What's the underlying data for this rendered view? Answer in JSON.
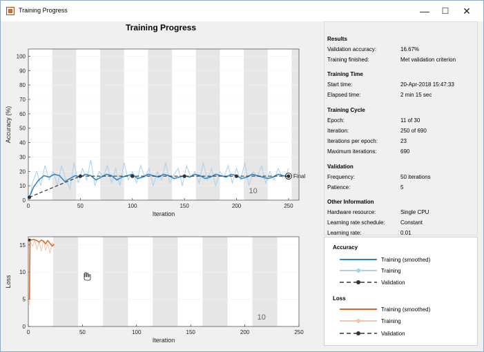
{
  "window": {
    "title": "Training Progress",
    "controls": {
      "minimize": "—",
      "maximize": "☐",
      "close": "✕"
    }
  },
  "plot_title": "Training Progress",
  "colors": {
    "accuracy_smoothed": "#2f86c8",
    "accuracy_raw": "#aad0ea",
    "validation": "#333333",
    "loss_smoothed": "#d9652c",
    "loss_raw": "#f3c4ae",
    "epoch_band": "#e6e6e6"
  },
  "chart_data": [
    {
      "type": "line",
      "name": "accuracy",
      "xlabel": "Iteration",
      "ylabel": "Accuracy (%)",
      "xlim": [
        0,
        260
      ],
      "ylim": [
        0,
        105
      ],
      "xticks": [
        0,
        50,
        100,
        150,
        200,
        250
      ],
      "yticks": [
        0,
        10,
        20,
        30,
        40,
        50,
        60,
        70,
        80,
        90,
        100
      ],
      "epoch_label": "10",
      "final_label": "Final",
      "epoch_bands": [
        [
          23,
          46
        ],
        [
          69,
          92
        ],
        [
          115,
          138
        ],
        [
          161,
          184
        ],
        [
          207,
          230
        ],
        [
          253,
          260
        ]
      ],
      "series": [
        {
          "name": "Training (smoothed)",
          "x": [
            1,
            5,
            10,
            15,
            20,
            25,
            30,
            35,
            40,
            45,
            50,
            55,
            60,
            65,
            70,
            75,
            80,
            85,
            90,
            95,
            100,
            105,
            110,
            115,
            120,
            125,
            130,
            135,
            140,
            145,
            150,
            155,
            160,
            165,
            170,
            175,
            180,
            185,
            190,
            195,
            200,
            205,
            210,
            215,
            220,
            225,
            230,
            235,
            240,
            245,
            250
          ],
          "y": [
            2,
            9,
            14,
            17,
            16,
            18,
            17,
            13,
            15,
            17,
            16,
            18,
            17,
            14,
            16,
            18,
            17,
            14,
            16,
            17,
            18,
            15,
            16,
            18,
            17,
            16,
            18,
            17,
            15,
            16,
            17,
            16,
            18,
            17,
            15,
            16,
            18,
            17,
            16,
            18,
            17,
            15,
            16,
            18,
            17,
            16,
            15,
            16,
            18,
            17,
            16
          ]
        },
        {
          "name": "Training",
          "x": [
            1,
            4,
            8,
            12,
            16,
            20,
            24,
            28,
            32,
            36,
            40,
            44,
            48,
            52,
            56,
            60,
            64,
            68,
            72,
            76,
            80,
            84,
            88,
            92,
            96,
            100,
            104,
            108,
            112,
            116,
            120,
            124,
            128,
            132,
            136,
            140,
            144,
            148,
            152,
            156,
            160,
            164,
            168,
            172,
            176,
            180,
            184,
            188,
            192,
            196,
            200,
            204,
            208,
            212,
            216,
            220,
            224,
            228,
            232,
            236,
            240,
            244,
            248,
            250
          ],
          "y": [
            0,
            12,
            20,
            10,
            24,
            14,
            20,
            10,
            24,
            14,
            8,
            26,
            12,
            22,
            14,
            28,
            10,
            20,
            16,
            24,
            12,
            22,
            10,
            26,
            14,
            20,
            12,
            24,
            16,
            22,
            10,
            20,
            14,
            26,
            12,
            18,
            22,
            10,
            24,
            16,
            20,
            12,
            26,
            14,
            22,
            10,
            20,
            16,
            24,
            12,
            22,
            14,
            26,
            10,
            20,
            16,
            24,
            12,
            20,
            14,
            22,
            16,
            18,
            22
          ]
        },
        {
          "name": "Validation",
          "x": [
            1,
            50,
            100,
            150,
            200,
            250
          ],
          "y": [
            2,
            16.67,
            16.67,
            16.67,
            16.67,
            16.67
          ]
        }
      ]
    },
    {
      "type": "line",
      "name": "loss",
      "xlabel": "Iteration",
      "ylabel": "Loss",
      "xlim": [
        0,
        250
      ],
      "ylim": [
        0,
        16.5
      ],
      "xticks": [
        0,
        50,
        100,
        150,
        200,
        250
      ],
      "yticks": [
        0,
        5,
        10,
        15
      ],
      "epoch_label": "10",
      "epoch_bands": [
        [
          23,
          46
        ],
        [
          69,
          92
        ],
        [
          115,
          138
        ],
        [
          161,
          184
        ],
        [
          207,
          230
        ]
      ],
      "series": [
        {
          "name": "Training (smoothed)",
          "x": [
            1,
            1.5,
            2,
            3,
            5,
            8,
            10,
            12,
            14,
            16,
            18,
            20,
            22,
            24
          ],
          "y": [
            5,
            15.8,
            16,
            15.9,
            16,
            15.8,
            15.5,
            15.9,
            15.7,
            15.2,
            15.8,
            15.3,
            14.8,
            15.1
          ]
        },
        {
          "name": "Training",
          "x": [
            1,
            2,
            4,
            6,
            8,
            10,
            12,
            14,
            16,
            18,
            20,
            22,
            24
          ],
          "y": [
            4,
            15.5,
            14.8,
            15.9,
            14.2,
            15.6,
            13.8,
            15.8,
            14.0,
            15.2,
            13.5,
            15.4,
            14.6
          ]
        },
        {
          "name": "Validation",
          "x": [
            1
          ],
          "y": [
            15.9
          ]
        }
      ]
    }
  ],
  "results": {
    "title": "Results",
    "rows": [
      {
        "label": "Validation accuracy:",
        "value": "16.67%"
      },
      {
        "label": "Training finished:",
        "value": "Met validation criterion"
      }
    ]
  },
  "training_time": {
    "title": "Training Time",
    "rows": [
      {
        "label": "Start time:",
        "value": "20-Apr-2018 15:47:33"
      },
      {
        "label": "Elapsed time:",
        "value": "2 min 15 sec"
      }
    ]
  },
  "training_cycle": {
    "title": "Training Cycle",
    "rows": [
      {
        "label": "Epoch:",
        "value": "11 of 30"
      },
      {
        "label": "Iteration:",
        "value": "250 of 690"
      },
      {
        "label": "Iterations per epoch:",
        "value": "23"
      },
      {
        "label": "Maximum iterations:",
        "value": "690"
      }
    ]
  },
  "validation": {
    "title": "Validation",
    "rows": [
      {
        "label": "Frequency:",
        "value": "50 iterations"
      },
      {
        "label": "Patience:",
        "value": "5"
      }
    ]
  },
  "other_info": {
    "title": "Other Information",
    "rows": [
      {
        "label": "Hardware resource:",
        "value": "Single CPU"
      },
      {
        "label": "Learning rate schedule:",
        "value": "Constant"
      },
      {
        "label": "Learning rate:",
        "value": "0.01"
      }
    ]
  },
  "legend": {
    "accuracy_title": "Accuracy",
    "loss_title": "Loss",
    "training_smoothed": "Training (smoothed)",
    "training": "Training",
    "validation": "Validation"
  }
}
